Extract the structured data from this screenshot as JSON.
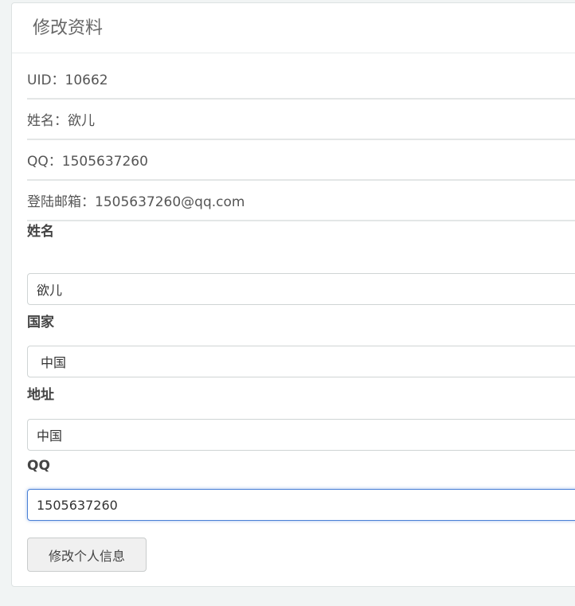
{
  "panel": {
    "title": "修改资料"
  },
  "info": {
    "uid": "UID：10662",
    "name": "姓名：欲儿",
    "qq": "QQ：1505637260",
    "email": "登陆邮箱：1505637260@qq.com"
  },
  "form": {
    "name_label": "姓名",
    "name_value": "欲儿",
    "country_label": "国家",
    "country_value": "中国",
    "address_label": "地址",
    "address_value": "中国",
    "qq_label": "QQ",
    "qq_value": "1505637260",
    "submit_label": "修改个人信息"
  },
  "colors": {
    "focus_border": "#4a80d6",
    "background": "#f1f4f4"
  }
}
